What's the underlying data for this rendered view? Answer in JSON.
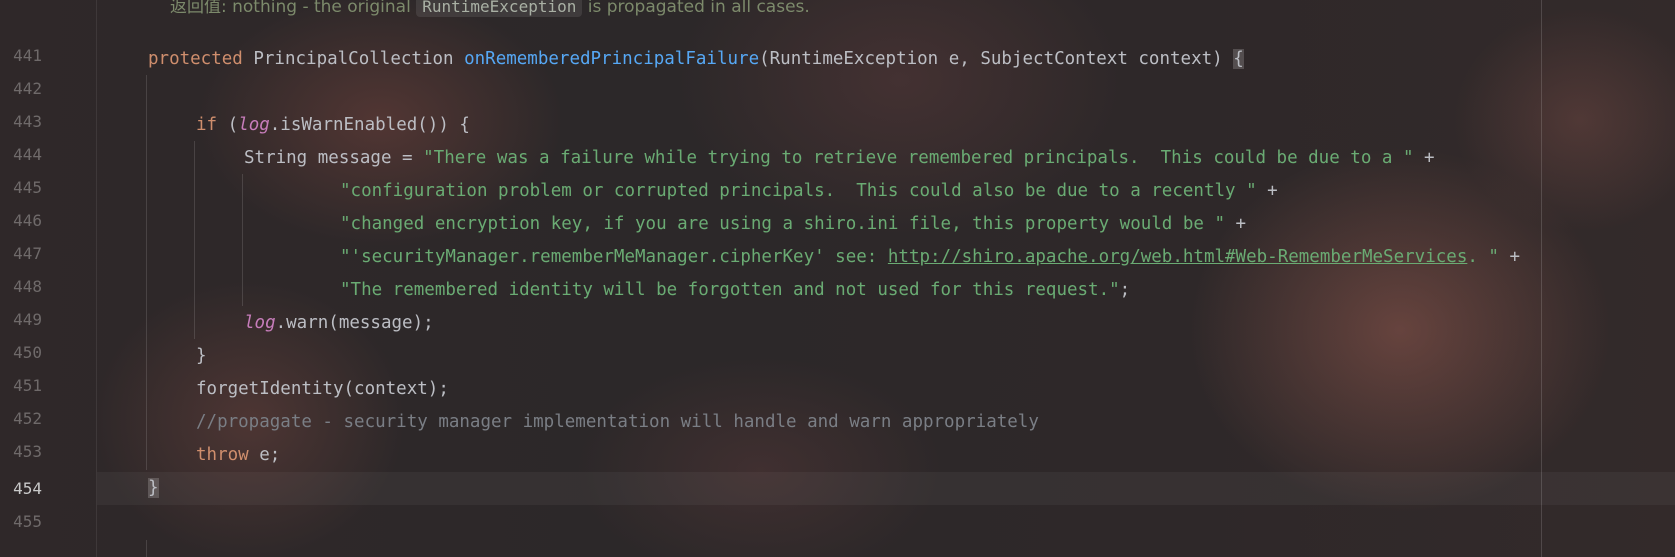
{
  "doc_comment": {
    "prefix": "返回值: nothing - the original",
    "code": "RuntimeException",
    "suffix": "is propagated in all cases."
  },
  "gutter": {
    "line_numbers": [
      "441",
      "442",
      "443",
      "444",
      "445",
      "446",
      "447",
      "448",
      "449",
      "450",
      "451",
      "452",
      "453",
      "454",
      "455"
    ],
    "current_line": "454"
  },
  "code": {
    "l441": {
      "kw": "protected",
      "type": " PrincipalCollection ",
      "method": "onRememberedPrincipalFailure",
      "params": "(RuntimeException e, SubjectContext context) ",
      "brace": "{"
    },
    "l443": {
      "kw": "if",
      "p1": " (",
      "field": "log",
      "p2": ".isWarnEnabled()) {"
    },
    "l444": {
      "decl": "String message = ",
      "str": "\"There was a failure while trying to retrieve remembered principals.  This could be due to a \"",
      "op": " +"
    },
    "l445": {
      "str": "\"configuration problem or corrupted principals.  This could also be due to a recently \"",
      "op": " +"
    },
    "l446": {
      "str": "\"changed encryption key, if you are using a shiro.ini file, this property would be \"",
      "op": " +"
    },
    "l447": {
      "str1": "\"'securityManager.rememberMeManager.cipherKey' see: ",
      "link": "http://shiro.apache.org/web.html#Web-RememberMeServices",
      "str2": ". \"",
      "op": " +"
    },
    "l448": {
      "str": "\"The remembered identity will be forgotten and not used for this request.\"",
      "end": ";"
    },
    "l449": {
      "field": "log",
      "rest": ".warn(message);"
    },
    "l450": {
      "text": "}"
    },
    "l451": {
      "text": "forgetIdentity(context);"
    },
    "l452": {
      "text": "//propagate - security manager implementation will handle and warn appropriately"
    },
    "l453": {
      "kw": "throw",
      "rest": " e;"
    },
    "l454": {
      "brace": "}"
    }
  }
}
